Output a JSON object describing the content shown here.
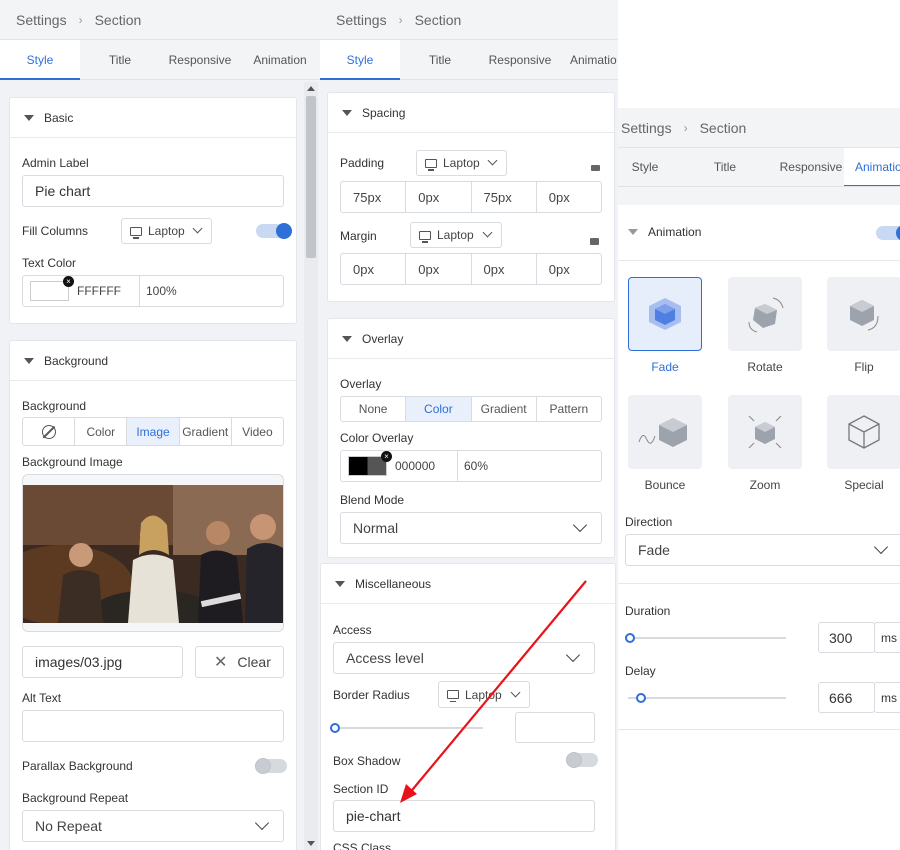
{
  "breadcrumb": {
    "root": "Settings",
    "child": "Section"
  },
  "tabs": [
    "Style",
    "Title",
    "Responsive",
    "Animation"
  ],
  "tabs_cut": [
    "Style",
    "Title",
    "Responsive",
    "Animatio"
  ],
  "tabs_cut3": [
    "Style",
    "Title",
    "Responsive",
    "Animatio"
  ],
  "panel1": {
    "basic": {
      "title": "Basic",
      "admin_label": "Admin Label",
      "admin_value": "Pie chart",
      "fill_columns": "Fill Columns",
      "device": "Laptop",
      "text_color": "Text Color",
      "color_hex": "FFFFFF",
      "color_opacity": "100%"
    },
    "background": {
      "title": "Background",
      "bg_label": "Background",
      "types": [
        "Color",
        "Image",
        "Gradient",
        "Video"
      ],
      "active": "Image",
      "image_label": "Background Image",
      "image_path": "images/03.jpg",
      "clear": "Clear",
      "alt_text": "Alt Text",
      "parallax": "Parallax Background",
      "repeat_label": "Background Repeat",
      "repeat_value": "No Repeat"
    }
  },
  "panel2": {
    "spacing": {
      "title": "Spacing",
      "padding": "Padding",
      "padding_device": "Laptop",
      "padding_values": [
        "75px",
        "0px",
        "75px",
        "0px"
      ],
      "margin": "Margin",
      "margin_device": "Laptop",
      "margin_values": [
        "0px",
        "0px",
        "0px",
        "0px"
      ]
    },
    "overlay": {
      "title": "Overlay",
      "overlay_label": "Overlay",
      "types": [
        "None",
        "Color",
        "Gradient",
        "Pattern"
      ],
      "active": "Color",
      "color_overlay": "Color Overlay",
      "hex": "000000",
      "opacity": "60%",
      "blend": "Blend Mode",
      "blend_value": "Normal"
    },
    "misc": {
      "title": "Miscellaneous",
      "access": "Access",
      "access_value": "Access level",
      "radius": "Border Radius",
      "radius_device": "Laptop",
      "box_shadow": "Box Shadow",
      "section_id": "Section ID",
      "section_id_value": "pie-chart",
      "css_class": "CSS Class"
    }
  },
  "panel3": {
    "animation": {
      "title": "Animation",
      "items": [
        "Fade",
        "Rotate",
        "Flip",
        "Bounce",
        "Zoom",
        "Special"
      ],
      "active": "Fade",
      "direction": "Direction",
      "direction_value": "Fade",
      "duration": "Duration",
      "duration_value": "300",
      "duration_unit": "ms",
      "duration_level": 0.0,
      "delay": "Delay",
      "delay_value": "666",
      "delay_unit": "ms",
      "delay_level": 0.07
    }
  },
  "colors": {
    "accent": "#2f6fd8",
    "arrow": "#e8121a"
  }
}
